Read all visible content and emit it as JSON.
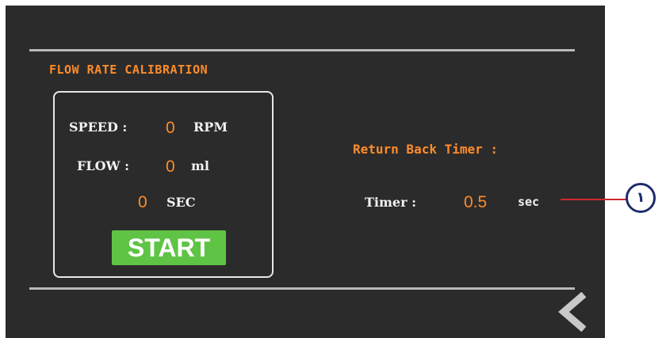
{
  "section_title": "FLOW RATE CALIBRATION",
  "calibration": {
    "speed_label": "SPEED :",
    "speed_value": "0",
    "speed_unit": "RPM",
    "flow_label": "FLOW :",
    "flow_value": "0",
    "flow_unit": "ml",
    "time_value": "0",
    "time_unit": "SEC",
    "start_label": "START"
  },
  "return_timer": {
    "title": "Return Back Timer :",
    "timer_label": "Timer :",
    "timer_value": "0.5",
    "timer_unit": "sec"
  },
  "annotation": {
    "marker_label": "١"
  },
  "icons": {
    "back": "chevron-left-icon"
  },
  "colors": {
    "background": "#2b2b2b",
    "accent": "#ff8c2a",
    "start_button": "#5fc445",
    "callout_line": "#d0282e",
    "callout_circle": "#1d2c6b"
  }
}
